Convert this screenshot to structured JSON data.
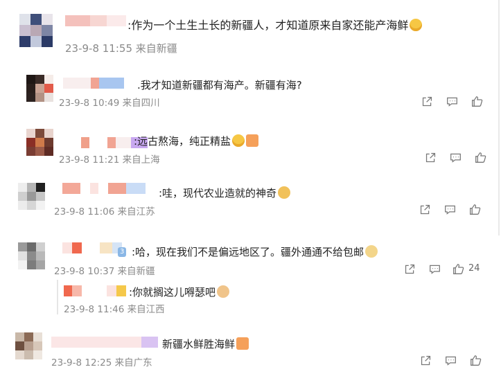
{
  "comments": [
    {
      "text": ":作为一个土生土长的新疆人，才知道原来自家还能产海鲜",
      "meta": "23-9-8 11:55 来自新疆",
      "emoji": "laugh-cry-emoji"
    },
    {
      "text": ".我才知道新疆都有海产。新疆有海?",
      "meta": "23-9-8 10:49 来自四川"
    },
    {
      "text": ":远古熬海，纯正精盐",
      "meta": "23-9-8 11:21 来自上海",
      "emoji": "laugh-and-fire-emoji"
    },
    {
      "text": ":哇，现代农业造就的神奇",
      "meta": "23-9-8 11:06 来自江苏",
      "emoji": "surprised-emoji"
    },
    {
      "text": ":哈，现在我们不是偏远地区了。疆外通通不给包邮",
      "meta": "23-9-8 10:37 来自新疆",
      "emoji": "dog-emoji",
      "badge": "3",
      "like_count": "24"
    },
    {
      "text": ":你就搁这儿嘚瑟吧",
      "meta": "23-9-8 11:46 来自江西",
      "emoji": "cat-emoji"
    },
    {
      "text": "新疆水鲜胜海鲜",
      "meta": "23-9-8 12:25 来自广东",
      "emoji": "fire-emoji"
    }
  ],
  "icons": {
    "share": "share-icon",
    "comment": "comment-icon",
    "like": "thumbs-up-icon"
  },
  "colors": {
    "text": "#222222",
    "meta": "#8a8a8a",
    "icon": "#777777"
  }
}
